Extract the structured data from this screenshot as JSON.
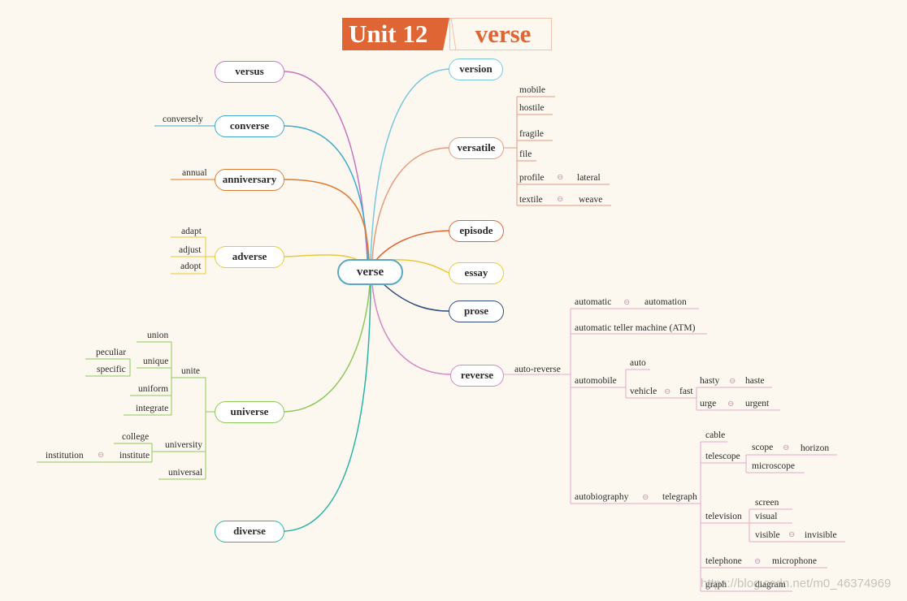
{
  "title": {
    "unit": "Unit 12",
    "word": "verse"
  },
  "center": "verse",
  "left_branches": {
    "versus": "versus",
    "converse": "converse",
    "converse_children": [
      "conversely"
    ],
    "anniversary": "anniversary",
    "anniversary_children": [
      "annual"
    ],
    "adverse": "adverse",
    "adverse_children": [
      "adapt",
      "adjust",
      "adopt"
    ],
    "universe": "universe",
    "unite": "unite",
    "unite_children": [
      "union",
      "unique",
      "uniform",
      "integrate"
    ],
    "unique_children": [
      "peculiar",
      "specific"
    ],
    "university": "university",
    "university_children": [
      "college",
      "institute"
    ],
    "institute_children": [
      "institution"
    ],
    "universal": "universal",
    "diverse": "diverse"
  },
  "right_branches": {
    "version": "version",
    "versatile": "versatile",
    "versatile_children": [
      "mobile",
      "hostile",
      "fragile",
      "file",
      "profile",
      "textile"
    ],
    "profile_related": "lateral",
    "textile_related": "weave",
    "episode": "episode",
    "essay": "essay",
    "prose": "prose",
    "reverse": "reverse",
    "auto_reverse": "auto-reverse",
    "automatic": "automatic",
    "automation": "automation",
    "atm": "automatic teller machine (ATM)",
    "automobile": "automobile",
    "auto": "auto",
    "vehicle": "vehicle",
    "fast": "fast",
    "hasty": "hasty",
    "haste": "haste",
    "urge": "urge",
    "urgent": "urgent",
    "autobiography": "autobiography",
    "telegraph": "telegraph",
    "cable": "cable",
    "telescope": "telescope",
    "scope": "scope",
    "horizon": "horizon",
    "microscope": "microscope",
    "television": "television",
    "screen": "screen",
    "visual": "visual",
    "visible": "visible",
    "invisible": "invisible",
    "telephone": "telephone",
    "microphone": "microphone",
    "graph": "graph",
    "diagram": "diagram"
  },
  "relation_symbol": "⊖",
  "watermark": "https://blog.csdn.net/m0_46374969",
  "colors": {
    "title_bg": "#e06535",
    "versus": "#c874c2",
    "converse": "#3fa9cf",
    "anniversary": "#e07a2e",
    "adverse": "#e8c83a",
    "universe": "#8cc95a",
    "diverse": "#2ab3a6",
    "version": "#79c7dc",
    "versatile": "#e49a7c",
    "episode": "#e06535",
    "essay": "#e8c83a",
    "prose": "#2f4b7c",
    "reverse": "#d487c4",
    "tree_line": "#e2a9c8"
  }
}
